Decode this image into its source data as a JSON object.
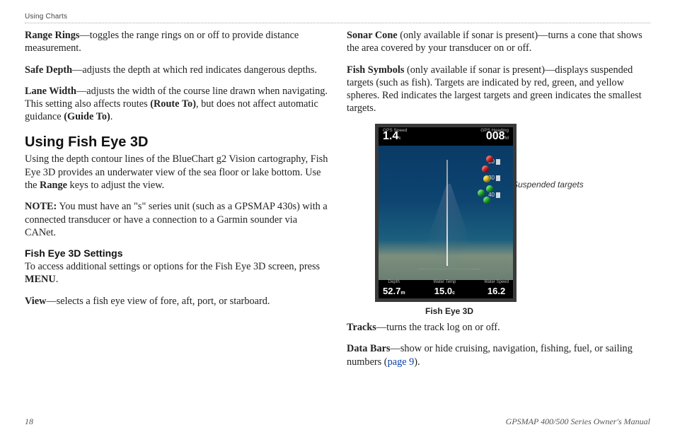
{
  "header": {
    "section": "Using Charts"
  },
  "footer": {
    "page": "18",
    "manual": "GPSMAP 400/500 Series Owner's Manual"
  },
  "left": {
    "p1": {
      "term": "Range Rings",
      "dash": "—",
      "text": "toggles the range rings on or off to provide distance measurement."
    },
    "p2": {
      "term": "Safe Depth",
      "dash": "—",
      "text": "adjusts the depth at which red indicates dangerous depths."
    },
    "p3": {
      "term": "Lane Width",
      "dash": "—",
      "a": "adjusts the width of the course line drawn when navigating. This setting also affects routes ",
      "bold1": "(Route To)",
      "b": ", but does not affect automatic guidance ",
      "bold2": "(Guide To)",
      "c": "."
    },
    "h2": "Using Fish Eye 3D",
    "p4a": "Using the depth contour lines of the BlueChart g2 Vision cartography, Fish Eye 3D provides an underwater view of the sea floor or lake bottom. Use the ",
    "p4bold": "Range",
    "p4b": " keys to adjust the view.",
    "note_label": "NOTE:",
    "note_text": " You must have an \"s\" series unit (such as a GPSMAP 430s) with a connected transducer or have a connection to a Garmin sounder via CANet.",
    "h3": "Fish Eye 3D Settings",
    "p5a": "To access additional settings or options for the Fish Eye 3D screen, press ",
    "p5bold": "MENU",
    "p5b": ".",
    "p6": {
      "term": "View",
      "dash": "—",
      "text": "selects a fish eye view of fore, aft, port, or starboard."
    }
  },
  "right": {
    "p1": {
      "term": "Sonar Cone",
      "note": " (only available if sonar is present)",
      "dash": "—",
      "text": "turns a cone that shows the area covered by your transducer on or off."
    },
    "p2": {
      "term": "Fish Symbols",
      "note": " (only available if sonar is present)",
      "dash": "—",
      "text": "displays suspended targets (such as fish). Targets are indicated by red, green, and yellow spheres. Red indicates the largest targets and green indicates the smallest targets."
    },
    "callout": "Suspended targets",
    "caption": "Fish Eye 3D",
    "p3": {
      "term": "Tracks",
      "dash": "—",
      "text": "turns the track log on or off."
    },
    "p4": {
      "term": "Data Bars",
      "dash": "—",
      "a": "show or hide cruising, navigation, fishing, fuel, or sailing numbers (",
      "link": "page 9",
      "b": ")."
    }
  },
  "fig": {
    "speed_label": "GPS Speed",
    "speed_value": "1.4",
    "speed_unit": "k",
    "heading_label": "GPS Heading",
    "heading_value": "008",
    "heading_unit": "M",
    "ticks": [
      "20",
      "30",
      "40"
    ],
    "depth_label": "Depth",
    "depth_value": "52.7",
    "depth_unit": "m",
    "wtemp_label": "Water Temp",
    "wtemp_value": "15.0",
    "wtemp_unit": "c",
    "wspeed_label": "Water Speed",
    "wspeed_value": "16.2",
    "wspeed_unit": ""
  }
}
